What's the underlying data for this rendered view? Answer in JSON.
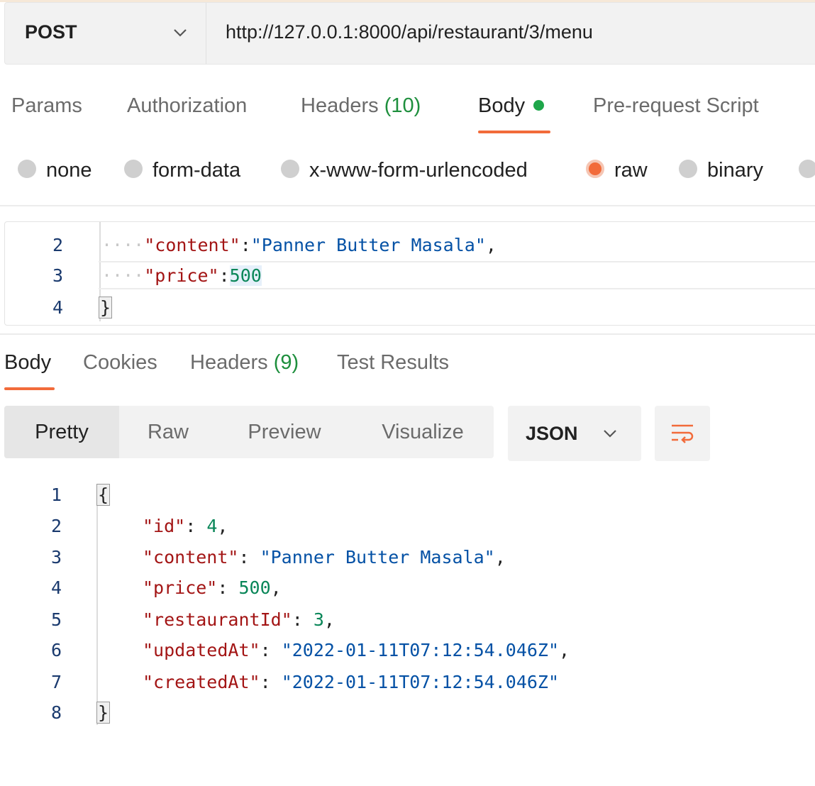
{
  "request": {
    "method": "POST",
    "url": "http://127.0.0.1:8000/api/restaurant/3/menu"
  },
  "request_tabs": {
    "params": "Params",
    "authorization": "Authorization",
    "headers_label": "Headers",
    "headers_count": "(10)",
    "body": "Body",
    "prerequest": "Pre-request Script"
  },
  "body_types": {
    "none": "none",
    "form_data": "form-data",
    "urlencoded": "x-www-form-urlencoded",
    "raw": "raw",
    "binary": "binary",
    "selected": "raw"
  },
  "request_editor": {
    "line_numbers": [
      "2",
      "3",
      "4"
    ],
    "line2": {
      "key": "\"content\"",
      "sep": ":",
      "value": "\"Panner Butter Masala\"",
      "trail": ","
    },
    "line3": {
      "key": "\"price\"",
      "sep": ":",
      "value": "500"
    },
    "line4": {
      "brace": "}"
    }
  },
  "response_tabs": {
    "body": "Body",
    "cookies": "Cookies",
    "headers_label": "Headers",
    "headers_count": "(9)",
    "test_results": "Test Results"
  },
  "view_modes": {
    "pretty": "Pretty",
    "raw": "Raw",
    "preview": "Preview",
    "visualize": "Visualize",
    "selected": "Pretty"
  },
  "format_select": {
    "value": "JSON"
  },
  "response_body": {
    "line_numbers": [
      "1",
      "2",
      "3",
      "4",
      "5",
      "6",
      "7",
      "8"
    ],
    "open_brace": "{",
    "close_brace": "}",
    "fields": [
      {
        "key": "\"id\"",
        "value": "4",
        "trail": ","
      },
      {
        "key": "\"content\"",
        "value": "\"Panner Butter Masala\"",
        "trail": ","
      },
      {
        "key": "\"price\"",
        "value": "500",
        "trail": ","
      },
      {
        "key": "\"restaurantId\"",
        "value": "3",
        "trail": ","
      },
      {
        "key": "\"updatedAt\"",
        "value": "\"2022-01-11T07:12:54.046Z\"",
        "trail": ","
      },
      {
        "key": "\"createdAt\"",
        "value": "\"2022-01-11T07:12:54.046Z\"",
        "trail": ""
      }
    ]
  },
  "colors": {
    "accent": "#f26b3a",
    "body_dot": "#1ea64a",
    "count_green": "#1e8f3d",
    "json_key": "#a31515",
    "json_string": "#0451a5",
    "json_number": "#098658"
  },
  "icons": {
    "method_dropdown": "chevron-down-icon",
    "format_dropdown": "chevron-down-icon",
    "wrap": "text-wrap-icon"
  }
}
